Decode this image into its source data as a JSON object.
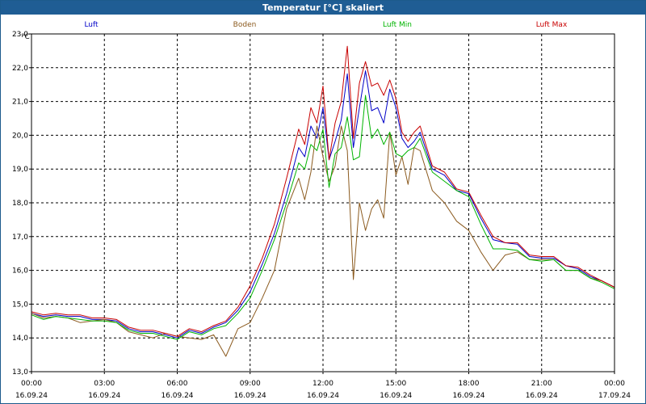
{
  "chart_data": {
    "type": "line",
    "title": "Temperatur [°C] skaliert",
    "ylabel": "°C",
    "xlabel": "",
    "ylim": [
      13.0,
      24.0
    ],
    "ytick_labels": [
      "13,0",
      "14,0",
      "15,0",
      "16,0",
      "17,0",
      "18,0",
      "19,0",
      "20,0",
      "21,0",
      "22,0",
      "23,0"
    ],
    "xlim": [
      0,
      24
    ],
    "x_unit": "hours",
    "xtick_times": [
      "00:00",
      "03:00",
      "06:00",
      "09:00",
      "12:00",
      "15:00",
      "18:00",
      "21:00",
      "00:00"
    ],
    "xtick_dates": [
      "16.09.24",
      "16.09.24",
      "16.09.24",
      "16.09.24",
      "16.09.24",
      "16.09.24",
      "16.09.24",
      "16.09.24",
      "17.09.24"
    ],
    "grid": true,
    "legend_position": "top",
    "series": [
      {
        "name": "Luft",
        "color": "#0000c8",
        "x": [
          0,
          0.5,
          1,
          1.5,
          2,
          2.5,
          3,
          3.5,
          4,
          4.5,
          5,
          5.5,
          6,
          6.5,
          7,
          7.5,
          8,
          8.5,
          9,
          9.5,
          10,
          10.5,
          11,
          11.25,
          11.5,
          11.75,
          12,
          12.25,
          12.5,
          12.75,
          13,
          13.25,
          13.5,
          13.75,
          14,
          14.25,
          14.5,
          14.75,
          15,
          15.25,
          15.5,
          15.75,
          16,
          16.5,
          17,
          17.5,
          18,
          18.5,
          19,
          19.5,
          20,
          20.5,
          21,
          21.5,
          22,
          22.5,
          23,
          23.5,
          24
        ],
        "y": [
          14.9,
          14.8,
          14.85,
          14.8,
          14.8,
          14.7,
          14.7,
          14.65,
          14.4,
          14.3,
          14.3,
          14.2,
          14.1,
          14.35,
          14.25,
          14.45,
          14.6,
          15.0,
          15.6,
          16.5,
          17.5,
          18.8,
          20.3,
          20.0,
          21.0,
          20.6,
          21.6,
          19.9,
          20.5,
          21.2,
          22.7,
          20.3,
          21.6,
          22.8,
          21.5,
          21.6,
          21.1,
          22.2,
          21.6,
          20.6,
          20.3,
          20.5,
          20.8,
          19.6,
          19.4,
          18.9,
          18.8,
          18.0,
          17.3,
          17.2,
          17.15,
          16.75,
          16.7,
          16.7,
          16.45,
          16.35,
          16.1,
          15.95,
          15.75
        ]
      },
      {
        "name": "Boden",
        "color": "#8b5a1e",
        "x": [
          0,
          0.5,
          1,
          1.5,
          2,
          2.5,
          3,
          3.5,
          4,
          4.5,
          5,
          5.5,
          6,
          6.5,
          7,
          7.5,
          8,
          8.5,
          9,
          9.5,
          10,
          10.5,
          11,
          11.25,
          11.5,
          11.75,
          12,
          12.25,
          12.5,
          12.75,
          13,
          13.25,
          13.5,
          13.75,
          14,
          14.25,
          14.5,
          14.75,
          15,
          15.25,
          15.5,
          15.75,
          16,
          16.5,
          17,
          17.5,
          18,
          18.5,
          19,
          19.5,
          20,
          20.5,
          21,
          21.5,
          22,
          22.5,
          23,
          23.5,
          24
        ],
        "y": [
          14.9,
          14.75,
          14.8,
          14.75,
          14.6,
          14.65,
          14.7,
          14.6,
          14.3,
          14.2,
          14.1,
          14.25,
          14.15,
          14.1,
          14.05,
          14.2,
          13.5,
          14.4,
          14.6,
          15.4,
          16.3,
          18.3,
          19.3,
          18.6,
          19.5,
          21.0,
          20.0,
          19.2,
          19.7,
          21.0,
          20.2,
          16.0,
          18.5,
          17.6,
          18.3,
          18.6,
          18.0,
          20.8,
          19.4,
          20.0,
          19.1,
          20.3,
          20.2,
          18.9,
          18.5,
          17.9,
          17.6,
          16.9,
          16.3,
          16.8,
          16.9,
          16.65,
          16.65,
          16.65,
          16.3,
          16.3,
          16.05,
          15.95,
          15.75
        ]
      },
      {
        "name": "Luft Min",
        "color": "#00b400",
        "x": [
          0,
          0.5,
          1,
          1.5,
          2,
          2.5,
          3,
          3.5,
          4,
          4.5,
          5,
          5.5,
          6,
          6.5,
          7,
          7.5,
          8,
          8.5,
          9,
          9.5,
          10,
          10.5,
          11,
          11.25,
          11.5,
          11.75,
          12,
          12.25,
          12.5,
          12.75,
          13,
          13.25,
          13.5,
          13.75,
          14,
          14.25,
          14.5,
          14.75,
          15,
          15.25,
          15.5,
          15.75,
          16,
          16.5,
          17,
          17.5,
          18,
          18.5,
          19,
          19.5,
          20,
          20.5,
          21,
          21.5,
          22,
          22.5,
          23,
          23.5,
          24
        ],
        "y": [
          14.85,
          14.7,
          14.8,
          14.75,
          14.7,
          14.65,
          14.65,
          14.6,
          14.35,
          14.25,
          14.25,
          14.15,
          14.05,
          14.3,
          14.2,
          14.4,
          14.5,
          14.9,
          15.4,
          16.3,
          17.3,
          18.5,
          19.8,
          19.6,
          20.4,
          20.2,
          20.9,
          19.0,
          20.1,
          20.3,
          21.3,
          19.9,
          20.0,
          22.0,
          20.6,
          20.9,
          20.4,
          20.8,
          20.1,
          20.0,
          20.2,
          20.3,
          20.6,
          19.5,
          19.2,
          18.9,
          18.7,
          17.8,
          17.0,
          17.0,
          16.95,
          16.65,
          16.6,
          16.65,
          16.3,
          16.3,
          16.05,
          15.9,
          15.7
        ]
      },
      {
        "name": "Luft Max",
        "color": "#c80000",
        "x": [
          0,
          0.5,
          1,
          1.5,
          2,
          2.5,
          3,
          3.5,
          4,
          4.5,
          5,
          5.5,
          6,
          6.5,
          7,
          7.5,
          8,
          8.5,
          9,
          9.5,
          10,
          10.5,
          11,
          11.25,
          11.5,
          11.75,
          12,
          12.25,
          12.5,
          12.75,
          13,
          13.25,
          13.5,
          13.75,
          14,
          14.25,
          14.5,
          14.75,
          15,
          15.25,
          15.5,
          15.75,
          16,
          16.5,
          17,
          17.5,
          18,
          18.5,
          19,
          19.5,
          20,
          20.5,
          21,
          21.5,
          22,
          22.5,
          23,
          23.5,
          24
        ],
        "y": [
          14.95,
          14.85,
          14.9,
          14.85,
          14.85,
          14.75,
          14.75,
          14.7,
          14.45,
          14.35,
          14.35,
          14.25,
          14.15,
          14.4,
          14.3,
          14.5,
          14.65,
          15.1,
          15.8,
          16.7,
          17.8,
          19.3,
          20.9,
          20.4,
          21.6,
          21.1,
          22.3,
          19.9,
          21.1,
          21.8,
          23.6,
          20.6,
          22.4,
          23.1,
          22.3,
          22.4,
          22.0,
          22.5,
          21.9,
          20.8,
          20.5,
          20.8,
          21.0,
          19.7,
          19.5,
          18.95,
          18.85,
          18.1,
          17.4,
          17.2,
          17.2,
          16.8,
          16.75,
          16.75,
          16.45,
          16.4,
          16.15,
          15.95,
          15.75
        ]
      }
    ]
  }
}
